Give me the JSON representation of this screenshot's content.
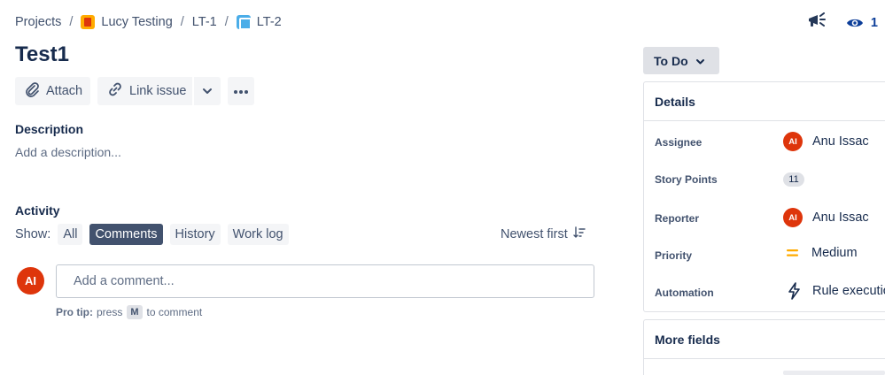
{
  "breadcrumb": {
    "projects": "Projects",
    "project": "Lucy Testing",
    "parent": "LT-1",
    "issue": "LT-2"
  },
  "header": {
    "watch_count": "1"
  },
  "issue": {
    "title": "Test1"
  },
  "actions": {
    "attach": "Attach",
    "link_issue": "Link issue"
  },
  "description": {
    "heading": "Description",
    "placeholder": "Add a description..."
  },
  "activity": {
    "heading": "Activity",
    "show_label": "Show:",
    "filters": [
      "All",
      "Comments",
      "History",
      "Work log"
    ],
    "active_filter": "Comments",
    "sort": "Newest first"
  },
  "comment": {
    "avatar_initials": "AI",
    "placeholder": "Add a comment...",
    "protip_label": "Pro tip:",
    "protip_press": "press",
    "protip_key": "M",
    "protip_suffix": "to comment"
  },
  "status": {
    "label": "To Do"
  },
  "details": {
    "heading": "Details",
    "fields": {
      "assignee": {
        "label": "Assignee",
        "value": "Anu Issac",
        "initials": "AI"
      },
      "story_points": {
        "label": "Story Points",
        "value": "11"
      },
      "reporter": {
        "label": "Reporter",
        "value": "Anu Issac",
        "initials": "AI"
      },
      "priority": {
        "label": "Priority",
        "value": "Medium"
      },
      "automation": {
        "label": "Automation",
        "value": "Rule executio"
      }
    }
  },
  "more_fields": {
    "heading": "More fields"
  },
  "colors": {
    "avatar": "#de350b",
    "priority_medium": "#ffab00",
    "active_chip": "#42526e",
    "watch": "#0c3e99"
  }
}
